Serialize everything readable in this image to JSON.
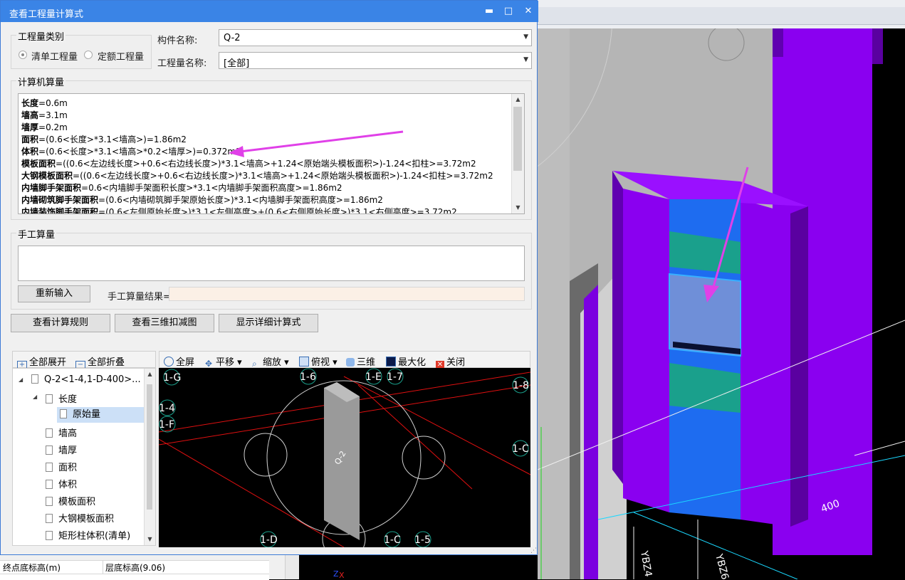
{
  "dialog": {
    "title": "查看工程量计算式",
    "min_glyph": "▬",
    "max_glyph": "□",
    "close_glyph": "✕"
  },
  "quantity_type": {
    "group_title": "工程量类别",
    "options": [
      "清单工程量",
      "定额工程量"
    ],
    "selected": "清单工程量"
  },
  "component": {
    "name_label": "构件名称:",
    "name_value": "Q-2",
    "qty_label": "工程量名称:",
    "qty_value": "[全部]"
  },
  "computer_calc": {
    "title": "计算机算量",
    "lines": [
      {
        "name": "长度",
        "expr": "=0.6m"
      },
      {
        "name": "墙高",
        "expr": "=3.1m"
      },
      {
        "name": "墙厚",
        "expr": "=0.2m"
      },
      {
        "name": "面积",
        "expr": "=(0.6<长度>*3.1<墙高>)=1.86m2"
      },
      {
        "name": "体积",
        "expr": "=(0.6<长度>*3.1<墙高>*0.2<墙厚>)=0.372m3"
      },
      {
        "name": "模板面积",
        "expr": "=((0.6<左边线长度>+0.6<右边线长度>)*3.1<墙高>+1.24<原始端头模板面积>)-1.24<扣柱>=3.72m2"
      },
      {
        "name": "大钢模板面积",
        "expr": "=((0.6<左边线长度>+0.6<右边线长度>)*3.1<墙高>+1.24<原始端头模板面积>)-1.24<扣柱>=3.72m2"
      },
      {
        "name": "内墙脚手架面积",
        "expr": "=0.6<内墙脚手架面积长度>*3.1<内墙脚手架面积高度>=1.86m2"
      },
      {
        "name": "内墙砌筑脚手架面积",
        "expr": "=(0.6<内墙砌筑脚手架原始长度>)*3.1<内墙脚手架面积高度>=1.86m2"
      },
      {
        "name": "内墙装饰脚手架面积",
        "expr": "=(0.6<左侧原始长度>)*3.1<左侧高度>+(0.6<右侧原始长度>)*3.1<右侧高度>=3.72m2"
      }
    ]
  },
  "manual_calc": {
    "title": "手工算量",
    "reinput_button": "重新输入",
    "result_label": "手工算量结果="
  },
  "actions": {
    "view_rules": "查看计算规则",
    "view_3d": "查看三维扣减图",
    "show_detail": "显示详细计算式"
  },
  "tree": {
    "expand_all": "全部展开",
    "collapse_all": "全部折叠",
    "root": "Q-2<1-4,1-D-400>...",
    "items": [
      {
        "label": "长度"
      },
      {
        "label": "原始量"
      },
      {
        "label": "墙高"
      },
      {
        "label": "墙厚"
      },
      {
        "label": "面积"
      },
      {
        "label": "体积"
      },
      {
        "label": "模板面积"
      },
      {
        "label": "大钢模板面积"
      },
      {
        "label": "矩形柱体积(清单)"
      }
    ]
  },
  "view_toolbar": {
    "fullscreen": "全屏",
    "pan": "平移",
    "zoom": "缩放",
    "topview": "俯视",
    "threed": "三维",
    "maximize": "最大化",
    "close": "关闭"
  },
  "plan_view": {
    "axis_labels": [
      "1-G",
      "1-6",
      "1-E",
      "1-7",
      "1-8",
      "1-4",
      "1-F",
      "1-C",
      "1-D",
      "1-C",
      "1-5"
    ],
    "wall_label": "Q-2"
  },
  "background": {
    "prop_rows": [
      {
        "name": "终点底标高(m)",
        "value": "层底标高(9.06)"
      }
    ],
    "axis_marks": [
      "YBZ4",
      "YBZ6",
      "400"
    ]
  },
  "colors": {
    "title_bar": "#3a84e6",
    "wall_purple": "#8a00f0",
    "wall_blue": "#1e6cf0",
    "wall_teal": "#1aa08c",
    "arrow_magenta": "#e040e8",
    "grid_red": "#e01010"
  }
}
